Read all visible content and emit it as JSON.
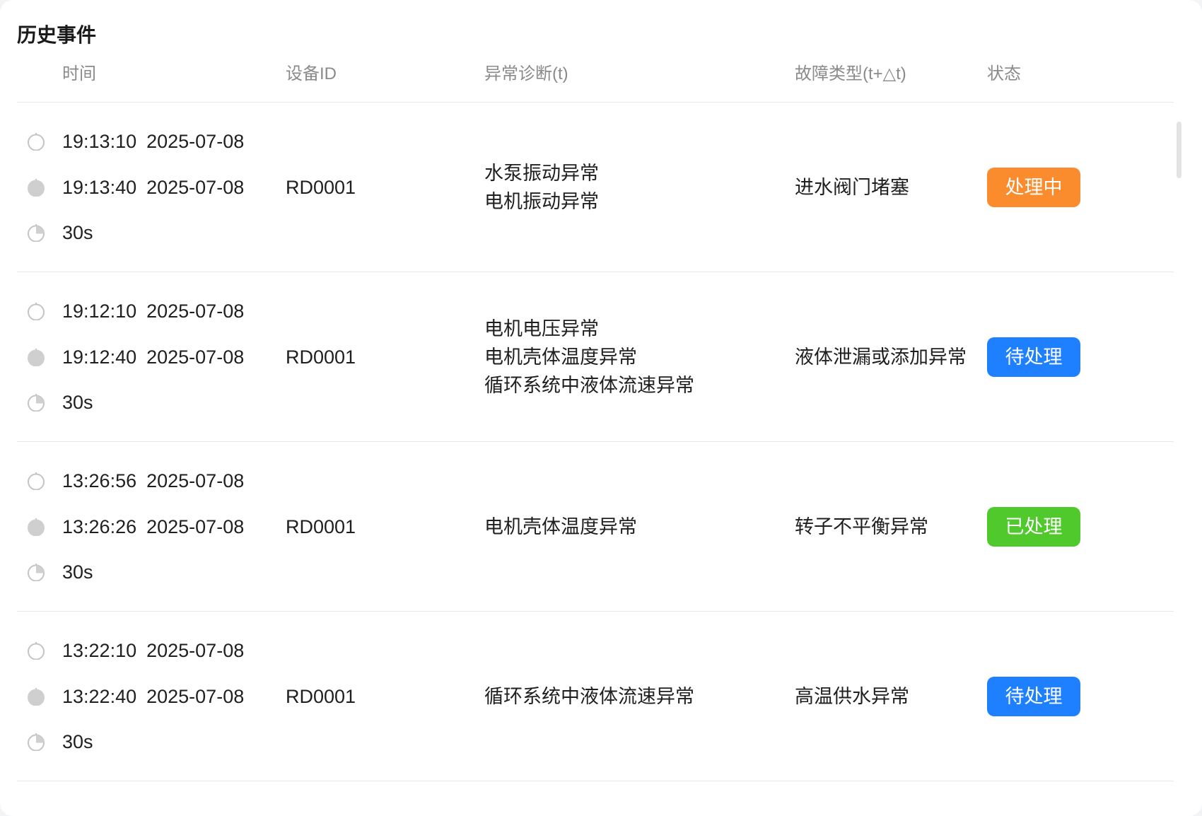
{
  "title": "历史事件",
  "header": {
    "time": "时间",
    "device_id": "设备ID",
    "anomaly": "异常诊断(t)",
    "fault_type": "故障类型(t+△t)",
    "status": "状态"
  },
  "colors": {
    "processing": "#fa8c2d",
    "pending": "#1e80ff",
    "done": "#4fc92b"
  },
  "icons": {
    "start": "stopwatch-outline-icon",
    "end": "stopwatch-filled-icon",
    "duration": "timer-quarter-icon"
  },
  "events": [
    {
      "start_time": "19:13:10",
      "start_date": "2025-07-08",
      "end_time": "19:13:40",
      "end_date": "2025-07-08",
      "duration": "30s",
      "device_id": "RD0001",
      "anomalies": [
        "水泵振动异常",
        "电机振动异常"
      ],
      "fault_type": "进水阀门堵塞",
      "status": "处理中",
      "status_kind": "processing"
    },
    {
      "start_time": "19:12:10",
      "start_date": "2025-07-08",
      "end_time": "19:12:40",
      "end_date": "2025-07-08",
      "duration": "30s",
      "device_id": "RD0001",
      "anomalies": [
        "电机电压异常",
        "电机壳体温度异常",
        "循环系统中液体流速异常"
      ],
      "fault_type": "液体泄漏或添加异常",
      "status": "待处理",
      "status_kind": "pending"
    },
    {
      "start_time": "13:26:56",
      "start_date": "2025-07-08",
      "end_time": "13:26:26",
      "end_date": "2025-07-08",
      "duration": "30s",
      "device_id": "RD0001",
      "anomalies": [
        "电机壳体温度异常"
      ],
      "fault_type": "转子不平衡异常",
      "status": "已处理",
      "status_kind": "done"
    },
    {
      "start_time": "13:22:10",
      "start_date": "2025-07-08",
      "end_time": "13:22:40",
      "end_date": "2025-07-08",
      "duration": "30s",
      "device_id": "RD0001",
      "anomalies": [
        "循环系统中液体流速异常"
      ],
      "fault_type": "高温供水异常",
      "status": "待处理",
      "status_kind": "pending"
    }
  ]
}
